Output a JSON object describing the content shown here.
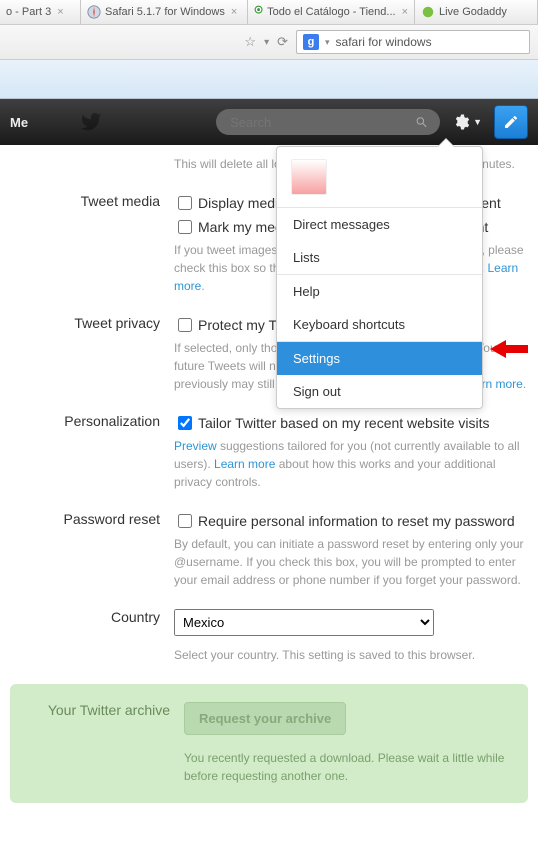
{
  "browser": {
    "tabs": [
      {
        "title": "o - Part 3"
      },
      {
        "title": "Safari 5.1.7 for Windows"
      },
      {
        "title": "Todo el Catálogo - Tiend..."
      },
      {
        "title": "Live Godaddy"
      }
    ],
    "address_query": "safari for windows"
  },
  "nav": {
    "me": "Me",
    "search_placeholder": "Search"
  },
  "dropdown": {
    "profile_name": "",
    "items": {
      "direct_messages": "Direct messages",
      "lists": "Lists",
      "help": "Help",
      "keyboard_shortcuts": "Keyboard shortcuts",
      "settings": "Settings",
      "sign_out": "Sign out"
    }
  },
  "settings": {
    "top_hint": "This will delete all locations, and this may take up to 30 minutes.",
    "tweet_media": {
      "label": "Tweet media",
      "opt1": "Display media that may contain sensitive content",
      "opt2": "Mark my media as containing sensitive content",
      "hint_pre": "If you tweet images or video that contain sensitive content, please check this box so that users are warned before they see it. ",
      "learn": "Learn more"
    },
    "tweet_privacy": {
      "label": "Tweet privacy",
      "opt": "Protect my Tweets",
      "hint_pre": "If selected, only those you approve will see your Tweets. Your future Tweets will not be available publicly. Tweets posted previously may still be publicly visible in some places. ",
      "learn": "Learn more"
    },
    "personalization": {
      "label": "Personalization",
      "opt": "Tailor Twitter based on my recent website visits",
      "preview": "Preview",
      "hint_mid": " suggestions tailored for you (not currently available to all users). ",
      "learn": "Learn more",
      "hint_post": " about how this works and your additional privacy controls."
    },
    "password_reset": {
      "label": "Password reset",
      "opt": "Require personal information to reset my password",
      "hint": "By default, you can initiate a password reset by entering only your @username. If you check this box, you will be prompted to enter your email address or phone number if you forget your password."
    },
    "country": {
      "label": "Country",
      "value": "Mexico",
      "hint": "Select your country. This setting is saved to this browser."
    },
    "archive": {
      "label": "Your Twitter archive",
      "button": "Request your archive",
      "hint": "You recently requested a download. Please wait a little while before requesting another one."
    }
  }
}
